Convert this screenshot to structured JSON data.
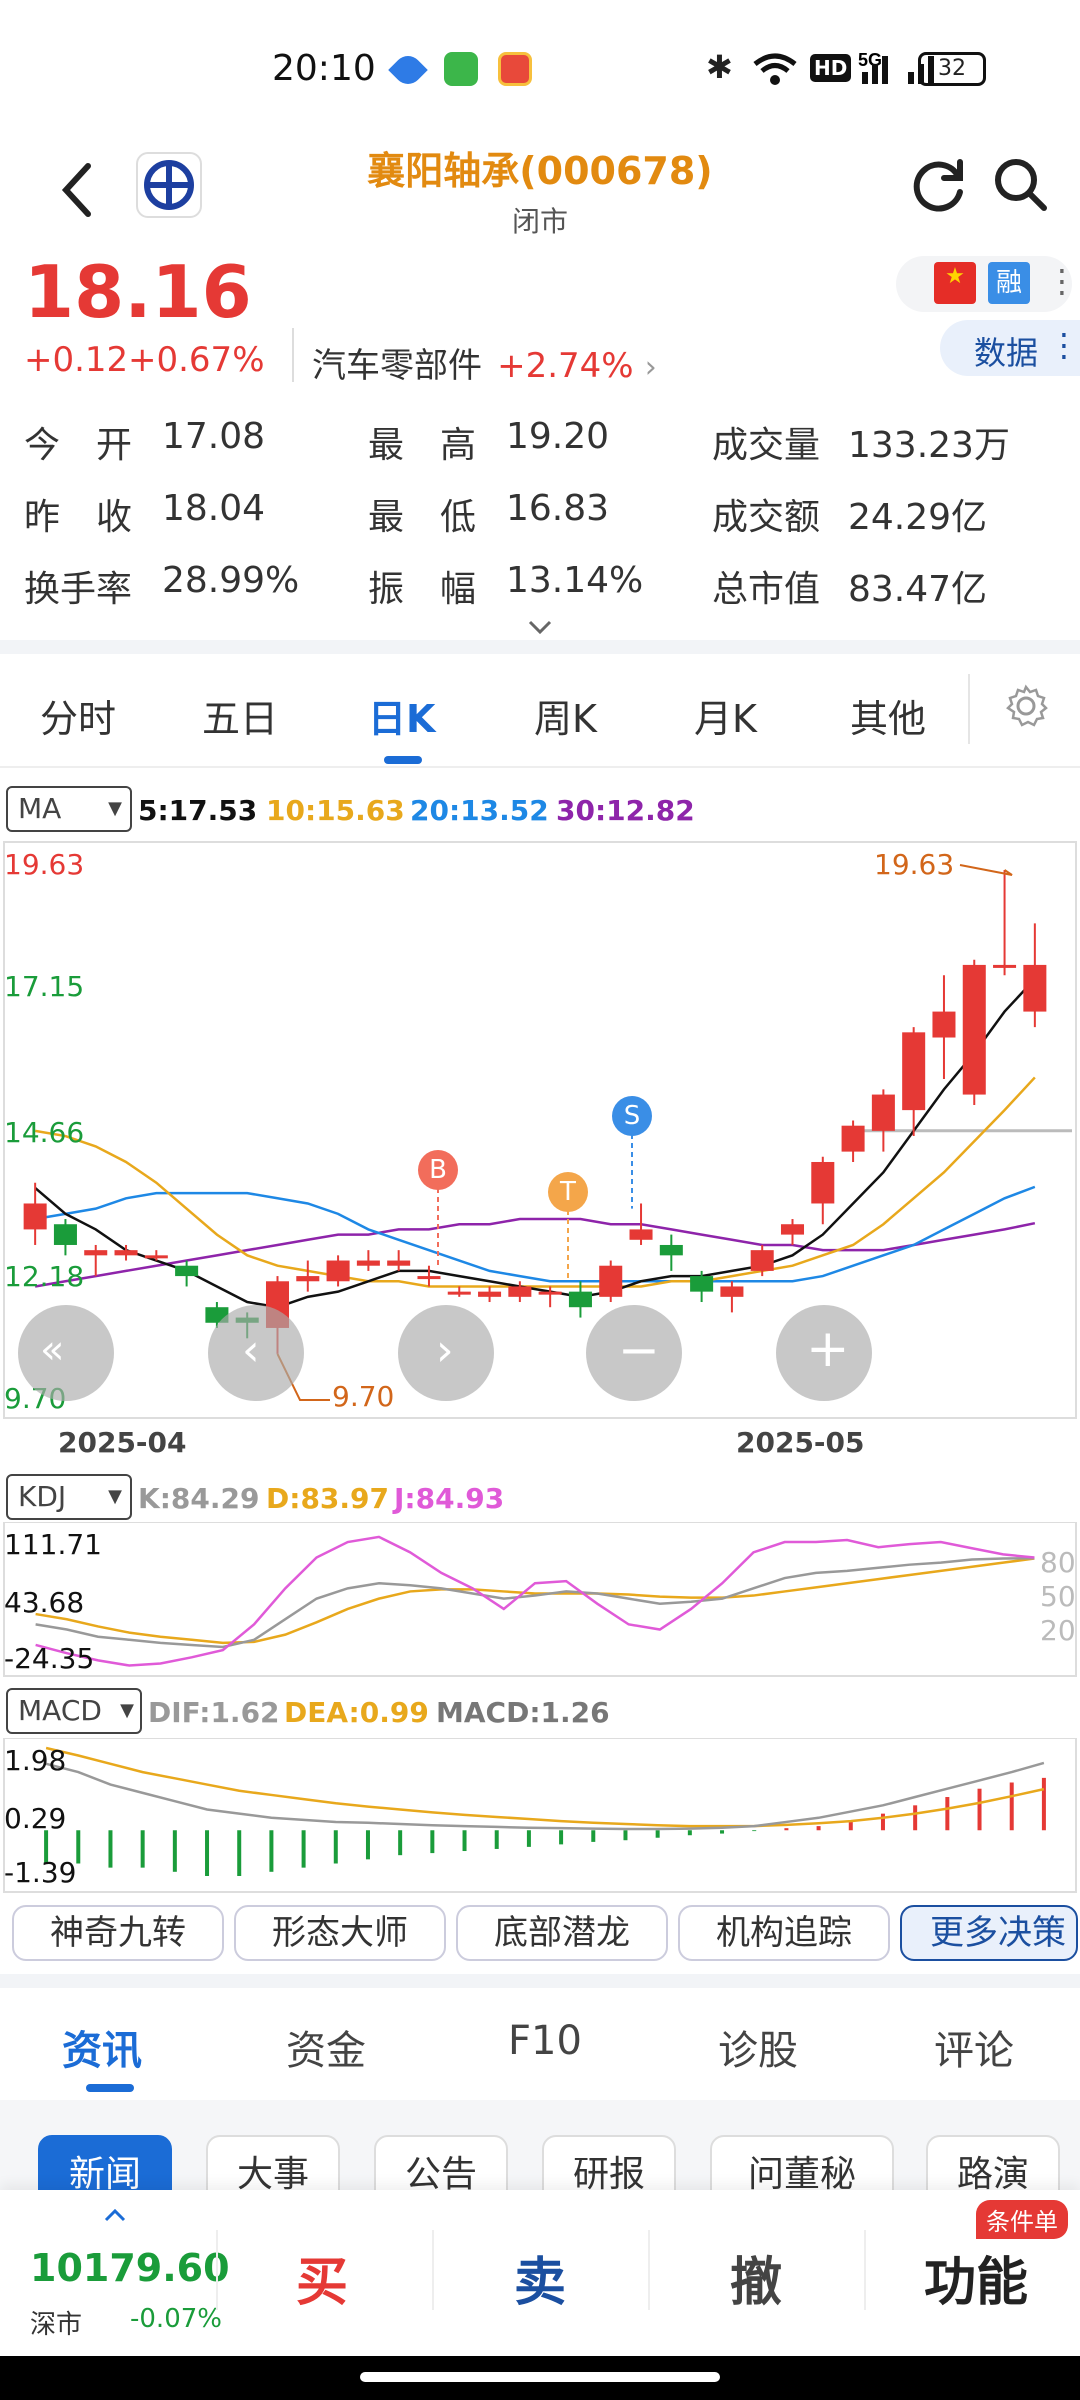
{
  "status_bar": {
    "time": "20:10",
    "battery": "32"
  },
  "header": {
    "title": "襄阳轴承(000678)",
    "subtitle": "闭市",
    "rong_badge": "融",
    "data_button": "数据"
  },
  "quote": {
    "price": "18.16",
    "change": "+0.12",
    "change_pct": "+0.67%",
    "sector_name": "汽车零部件",
    "sector_change": "+2.74%",
    "stats": [
      {
        "label": "今　开",
        "value": "17.08"
      },
      {
        "label": "最　高",
        "value": "19.20"
      },
      {
        "label": "成交量",
        "value": "133.23万"
      },
      {
        "label": "昨　收",
        "value": "18.04"
      },
      {
        "label": "最　低",
        "value": "16.83"
      },
      {
        "label": "成交额",
        "value": "24.29亿"
      },
      {
        "label": "换手率",
        "value": "28.99%"
      },
      {
        "label": "振　幅",
        "value": "13.14%"
      },
      {
        "label": "总市值",
        "value": "83.47亿"
      }
    ]
  },
  "period_tabs": [
    "分时",
    "五日",
    "日K",
    "周K",
    "月K",
    "其他"
  ],
  "main_chart": {
    "indicator": "MA",
    "ma": {
      "ma5": "5:17.53",
      "ma10": "10:15.63",
      "ma20": "20:13.52",
      "ma30": "30:12.82"
    },
    "y_labels": [
      "19.63",
      "17.15",
      "14.66",
      "12.18",
      "9.70"
    ],
    "x_labels": [
      "2025-04",
      "2025-05"
    ],
    "high_annot": "19.63",
    "low_annot": "9.70",
    "markers": [
      "B",
      "T",
      "S"
    ]
  },
  "kdj": {
    "indicator": "KDJ",
    "k": "K:84.29",
    "d": "D:83.97",
    "j": "J:84.93",
    "y_labels": [
      "111.71",
      "43.68",
      "-24.35"
    ],
    "right_labels": [
      "80",
      "50",
      "20"
    ]
  },
  "macd": {
    "indicator": "MACD",
    "dif": "DIF:1.62",
    "dea": "DEA:0.99",
    "macd": "MACD:1.26",
    "y_labels": [
      "1.98",
      "0.29",
      "-1.39"
    ]
  },
  "strategy_buttons": [
    "神奇九转",
    "形态大师",
    "底部潜龙",
    "机构追踪",
    "更多决策"
  ],
  "news_tabs": [
    "资讯",
    "资金",
    "F10",
    "诊股",
    "评论"
  ],
  "news_pills": [
    "新闻",
    "大事",
    "公告",
    "研报",
    "问董秘",
    "路演"
  ],
  "bottom_bar": {
    "index_value": "10179.60",
    "index_name": "深市",
    "index_change": "-0.07%",
    "buy": "买",
    "sell": "卖",
    "cancel": "撤",
    "function": "功能",
    "cond_badge": "条件单"
  },
  "colors": {
    "up": "#e53935",
    "down": "#1a9c3a",
    "accent": "#1b6cd6",
    "title": "#e28a10",
    "ma5": "#111111",
    "ma10": "#e8a81c",
    "ma20": "#1e88e5",
    "ma30": "#8e24aa"
  },
  "chart_data": {
    "type": "candlestick",
    "ylim": [
      9.7,
      19.63
    ],
    "candles": [
      {
        "o": 12.7,
        "c": 13.2,
        "h": 13.6,
        "l": 12.4
      },
      {
        "o": 12.8,
        "c": 12.4,
        "h": 12.9,
        "l": 12.2
      },
      {
        "o": 12.2,
        "c": 12.3,
        "h": 12.4,
        "l": 11.8
      },
      {
        "o": 12.2,
        "c": 12.3,
        "h": 12.4,
        "l": 12.1
      },
      {
        "o": 12.2,
        "c": 12.2,
        "h": 12.3,
        "l": 12.1
      },
      {
        "o": 12.0,
        "c": 11.8,
        "h": 12.1,
        "l": 11.6
      },
      {
        "o": 11.2,
        "c": 10.9,
        "h": 11.3,
        "l": 10.8
      },
      {
        "o": 11.0,
        "c": 10.9,
        "h": 11.1,
        "l": 10.6
      },
      {
        "o": 10.8,
        "c": 11.7,
        "h": 11.8,
        "l": 10.3
      },
      {
        "o": 11.7,
        "c": 11.8,
        "h": 12.1,
        "l": 11.5
      },
      {
        "o": 11.7,
        "c": 12.1,
        "h": 12.2,
        "l": 11.6
      },
      {
        "o": 12.0,
        "c": 12.1,
        "h": 12.3,
        "l": 11.9
      },
      {
        "o": 12.0,
        "c": 12.1,
        "h": 12.3,
        "l": 11.9
      },
      {
        "o": 11.8,
        "c": 11.8,
        "h": 12.0,
        "l": 11.6
      },
      {
        "o": 11.5,
        "c": 11.5,
        "h": 11.6,
        "l": 11.4
      },
      {
        "o": 11.4,
        "c": 11.5,
        "h": 11.6,
        "l": 11.3
      },
      {
        "o": 11.4,
        "c": 11.6,
        "h": 11.7,
        "l": 11.3
      },
      {
        "o": 11.5,
        "c": 11.5,
        "h": 11.6,
        "l": 11.2
      },
      {
        "o": 11.5,
        "c": 11.2,
        "h": 11.7,
        "l": 11.0
      },
      {
        "o": 11.4,
        "c": 12.0,
        "h": 12.1,
        "l": 11.3
      },
      {
        "o": 12.5,
        "c": 12.7,
        "h": 13.2,
        "l": 12.4
      },
      {
        "o": 12.4,
        "c": 12.2,
        "h": 12.6,
        "l": 11.9
      },
      {
        "o": 11.8,
        "c": 11.5,
        "h": 11.9,
        "l": 11.3
      },
      {
        "o": 11.4,
        "c": 11.6,
        "h": 11.7,
        "l": 11.1
      },
      {
        "o": 11.9,
        "c": 12.3,
        "h": 12.4,
        "l": 11.8
      },
      {
        "o": 12.6,
        "c": 12.8,
        "h": 12.9,
        "l": 12.4
      },
      {
        "o": 13.2,
        "c": 14.0,
        "h": 14.1,
        "l": 12.8
      },
      {
        "o": 14.2,
        "c": 14.7,
        "h": 14.8,
        "l": 14.0
      },
      {
        "o": 14.6,
        "c": 15.3,
        "h": 15.4,
        "l": 14.2
      },
      {
        "o": 15.0,
        "c": 16.5,
        "h": 16.6,
        "l": 14.5
      },
      {
        "o": 16.4,
        "c": 16.9,
        "h": 17.6,
        "l": 15.6
      },
      {
        "o": 15.3,
        "c": 17.8,
        "h": 17.9,
        "l": 15.1
      },
      {
        "o": 17.8,
        "c": 17.8,
        "h": 19.63,
        "l": 17.6
      },
      {
        "o": 16.9,
        "c": 17.8,
        "h": 18.6,
        "l": 16.6
      }
    ],
    "ma5": [
      13.5,
      13.0,
      12.7,
      12.3,
      12.1,
      11.9,
      11.6,
      11.3,
      11.2,
      11.4,
      11.5,
      11.7,
      11.9,
      11.9,
      11.8,
      11.7,
      11.6,
      11.5,
      11.4,
      11.5,
      11.7,
      11.8,
      11.8,
      11.9,
      12.0,
      12.2,
      12.6,
      13.2,
      13.8,
      14.6,
      15.4,
      16.1,
      16.9,
      17.53
    ],
    "ma10": [
      14.6,
      14.5,
      14.3,
      14.0,
      13.6,
      13.1,
      12.6,
      12.2,
      12.0,
      11.9,
      11.8,
      11.7,
      11.7,
      11.6,
      11.6,
      11.6,
      11.6,
      11.6,
      11.6,
      11.6,
      11.6,
      11.7,
      11.7,
      11.8,
      11.9,
      12.0,
      12.2,
      12.4,
      12.8,
      13.3,
      13.8,
      14.4,
      15.0,
      15.63
    ],
    "ma20": [
      12.9,
      13.0,
      13.1,
      13.3,
      13.4,
      13.4,
      13.4,
      13.4,
      13.3,
      13.2,
      13.0,
      12.7,
      12.5,
      12.3,
      12.1,
      11.9,
      11.8,
      11.7,
      11.7,
      11.7,
      11.7,
      11.7,
      11.7,
      11.7,
      11.7,
      11.7,
      11.8,
      12.0,
      12.2,
      12.4,
      12.7,
      13.0,
      13.3,
      13.52
    ],
    "ma30": [
      11.6,
      11.7,
      11.8,
      11.9,
      12.0,
      12.1,
      12.2,
      12.3,
      12.4,
      12.5,
      12.6,
      12.6,
      12.7,
      12.7,
      12.8,
      12.8,
      12.9,
      12.9,
      12.9,
      12.8,
      12.8,
      12.7,
      12.6,
      12.5,
      12.4,
      12.4,
      12.3,
      12.3,
      12.3,
      12.4,
      12.5,
      12.6,
      12.7,
      12.82
    ],
    "kdj_k": [
      20,
      15,
      8,
      5,
      2,
      0,
      -2,
      5,
      25,
      45,
      55,
      60,
      58,
      55,
      50,
      45,
      48,
      52,
      50,
      45,
      40,
      42,
      45,
      55,
      65,
      70,
      72,
      75,
      78,
      80,
      83,
      84,
      84.29
    ],
    "kdj_d": [
      30,
      25,
      18,
      12,
      8,
      5,
      2,
      3,
      10,
      22,
      35,
      45,
      52,
      54,
      54,
      52,
      50,
      50,
      50,
      49,
      47,
      46,
      46,
      48,
      52,
      56,
      60,
      64,
      68,
      72,
      76,
      80,
      83.97
    ],
    "kdj_j": [
      0,
      -8,
      -15,
      -20,
      -18,
      -12,
      -5,
      20,
      55,
      85,
      100,
      105,
      90,
      70,
      55,
      35,
      60,
      62,
      40,
      20,
      15,
      35,
      60,
      90,
      100,
      100,
      102,
      95,
      98,
      100,
      94,
      88,
      84.93
    ],
    "macd_dif": [
      1.6,
      1.4,
      1.1,
      0.9,
      0.7,
      0.5,
      0.4,
      0.3,
      0.25,
      0.2,
      0.18,
      0.15,
      0.12,
      0.1,
      0.08,
      0.06,
      0.05,
      0.04,
      0.03,
      0.03,
      0.04,
      0.06,
      0.1,
      0.2,
      0.3,
      0.45,
      0.6,
      0.8,
      1.0,
      1.2,
      1.4,
      1.62
    ],
    "macd_dea": [
      1.98,
      1.8,
      1.6,
      1.4,
      1.25,
      1.1,
      0.95,
      0.85,
      0.75,
      0.65,
      0.57,
      0.5,
      0.43,
      0.37,
      0.32,
      0.27,
      0.22,
      0.18,
      0.15,
      0.12,
      0.1,
      0.1,
      0.1,
      0.13,
      0.17,
      0.22,
      0.3,
      0.4,
      0.52,
      0.66,
      0.82,
      0.99
    ],
    "macd_hist": [
      -0.8,
      -0.8,
      -0.9,
      -0.9,
      -1.0,
      -1.1,
      -1.1,
      -1.0,
      -0.9,
      -0.8,
      -0.7,
      -0.6,
      -0.55,
      -0.5,
      -0.45,
      -0.4,
      -0.34,
      -0.28,
      -0.24,
      -0.18,
      -0.12,
      -0.08,
      -0.02,
      0.05,
      0.1,
      0.2,
      0.4,
      0.6,
      0.8,
      1.0,
      1.15,
      1.26
    ]
  }
}
